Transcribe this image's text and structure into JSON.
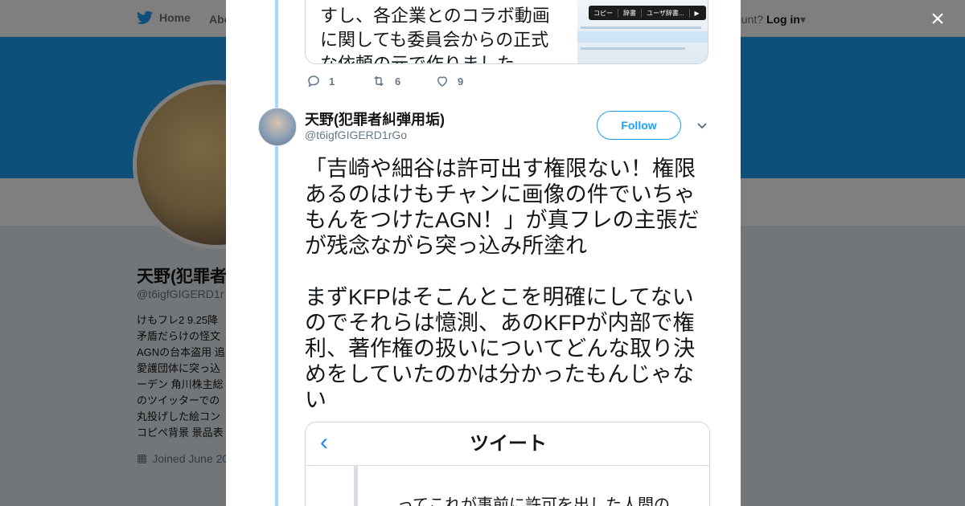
{
  "topbar": {
    "home_label": "Home",
    "about_label": "Abo",
    "account_prompt": "ccount?",
    "login_label": "Log in"
  },
  "profile": {
    "name": "天野(犯罪者",
    "handle": "@t6igfGIGERD1r",
    "bio": "けもフレ2 9.25降\n矛盾だらけの怪文\nAGNの台本盗用 追\n愛護団体に突っ込\nーデン 角川株主総\nのツイッターでの\n丸投げした絵コン\nコピペ背景 景品表",
    "joined": "Joined June 20"
  },
  "modal": {
    "quoted_tweet": {
      "text": "すし、各企業とのコラボ動画に関しても委員会からの正式な依頼の元で作りました。",
      "image_menu": [
        "コピー",
        "辞書",
        "ユーザ辞書...",
        "▶"
      ]
    },
    "actions": {
      "replies": "1",
      "retweets": "6",
      "likes": "9"
    },
    "tweet": {
      "author_name": "天野(犯罪者糾弾用垢)",
      "author_handle": "@t6igfGIGERD1rGo",
      "follow_label": "Follow",
      "text": "「吉崎や細谷は許可出す権限ない！権限あるのはけもチャンに画像の件でいちゃもんをつけたAGN！」が真フレの主張だが残念ながら突っ込み所塗れ\n\nまずKFPはそこんとこを明確にしてないのでそれらは憶測、あのKFPが内部で権利、著作権の扱いについてどんな取り決めをしていたのかは分かったもんじゃない",
      "image": {
        "screen_title": "ツイート",
        "body_text": "ってこれが事前に許可を出した人間の"
      }
    },
    "close_label": "×"
  },
  "colors": {
    "accent": "#1da1f2",
    "thread": "#a7d8f9",
    "text": "#14171a",
    "muted": "#657786"
  }
}
